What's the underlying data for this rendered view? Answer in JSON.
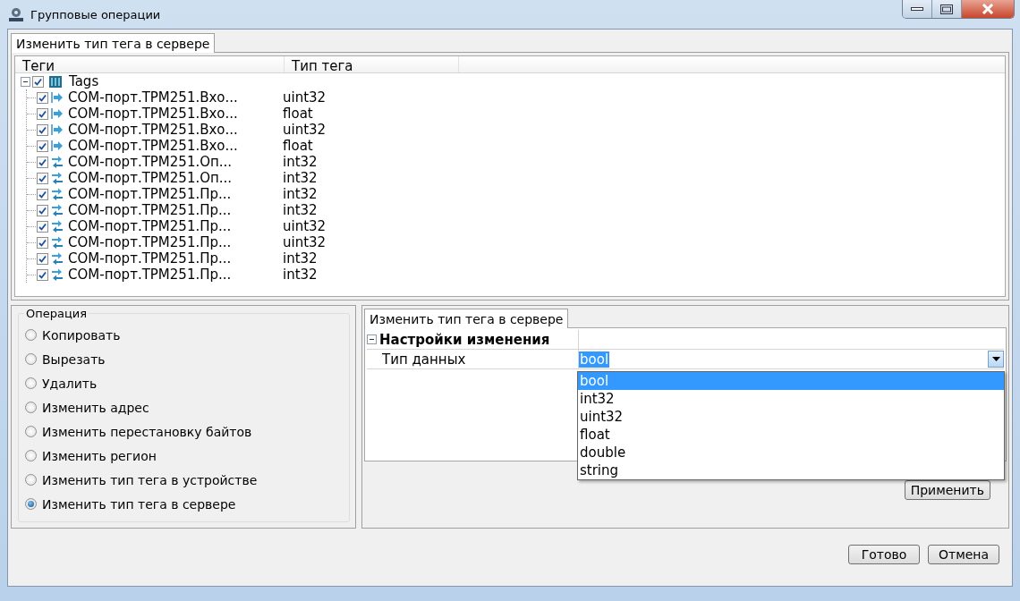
{
  "window": {
    "title": "Групповые операции"
  },
  "top_tabs": [
    {
      "label": "Изменить тип тега в сервере",
      "selected": true
    }
  ],
  "tag_tree": {
    "columns": [
      "Теги",
      "Тип тега"
    ],
    "root": {
      "label": "Tags",
      "checked": true,
      "expanded": true,
      "children": [
        {
          "name": "COM-порт.ТРМ251.Вхо...",
          "type": "uint32",
          "checked": true,
          "kind": "input"
        },
        {
          "name": "COM-порт.ТРМ251.Вхо...",
          "type": "float",
          "checked": true,
          "kind": "input"
        },
        {
          "name": "COM-порт.ТРМ251.Вхо...",
          "type": "uint32",
          "checked": true,
          "kind": "input"
        },
        {
          "name": "COM-порт.ТРМ251.Вхо...",
          "type": "float",
          "checked": true,
          "kind": "input"
        },
        {
          "name": "COM-порт.ТРМ251.Оп...",
          "type": "int32",
          "checked": true,
          "kind": "exchange"
        },
        {
          "name": "COM-порт.ТРМ251.Оп...",
          "type": "int32",
          "checked": true,
          "kind": "exchange"
        },
        {
          "name": "COM-порт.ТРМ251.Пр...",
          "type": "int32",
          "checked": true,
          "kind": "exchange"
        },
        {
          "name": "COM-порт.ТРМ251.Пр...",
          "type": "int32",
          "checked": true,
          "kind": "exchange"
        },
        {
          "name": "COM-порт.ТРМ251.Пр...",
          "type": "uint32",
          "checked": true,
          "kind": "exchange"
        },
        {
          "name": "COM-порт.ТРМ251.Пр...",
          "type": "uint32",
          "checked": true,
          "kind": "exchange"
        },
        {
          "name": "COM-порт.ТРМ251.Пр...",
          "type": "int32",
          "checked": true,
          "kind": "exchange"
        },
        {
          "name": "COM-порт.ТРМ251.Пр...",
          "type": "int32",
          "checked": true,
          "kind": "exchange"
        }
      ]
    }
  },
  "operation": {
    "title": "Операция",
    "options": [
      {
        "label": "Копировать",
        "selected": false
      },
      {
        "label": "Вырезать",
        "selected": false
      },
      {
        "label": "Удалить",
        "selected": false
      },
      {
        "label": "Изменить адрес",
        "selected": false
      },
      {
        "label": "Изменить перестановку байтов",
        "selected": false
      },
      {
        "label": "Изменить регион",
        "selected": false
      },
      {
        "label": "Изменить тип тега в устройстве",
        "selected": false
      },
      {
        "label": "Изменить тип тега в сервере",
        "selected": true
      }
    ]
  },
  "settings_panel": {
    "tabs": [
      {
        "label": "Изменить тип тега в сервере",
        "selected": true
      }
    ],
    "category": {
      "label": "Настройки изменения",
      "expanded": true
    },
    "properties": [
      {
        "name": "Тип данных",
        "value": "bool"
      }
    ],
    "dropdown": {
      "open": true,
      "options": [
        {
          "label": "bool",
          "selected": true
        },
        {
          "label": "int32",
          "selected": false
        },
        {
          "label": "uint32",
          "selected": false
        },
        {
          "label": "float",
          "selected": false
        },
        {
          "label": "double",
          "selected": false
        },
        {
          "label": "string",
          "selected": false
        }
      ]
    },
    "apply_button": "Применить"
  },
  "buttons": [
    "Готово",
    "Отмена"
  ]
}
